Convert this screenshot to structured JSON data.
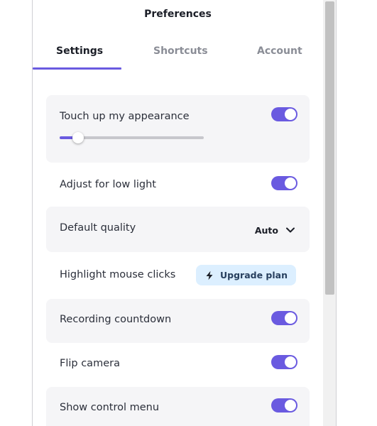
{
  "window": {
    "title": "Preferences"
  },
  "tabs": [
    {
      "label": "Settings",
      "active": true
    },
    {
      "label": "Shortcuts",
      "active": false
    },
    {
      "label": "Account",
      "active": false
    }
  ],
  "settings": {
    "touch_up": {
      "label": "Touch up my appearance",
      "enabled": true,
      "level": 0.13
    },
    "low_light": {
      "label": "Adjust for low light",
      "enabled": true
    },
    "quality": {
      "label": "Default quality",
      "value": "Auto"
    },
    "mouse_clicks": {
      "label": "Highlight mouse clicks",
      "button_label": "Upgrade plan"
    },
    "countdown": {
      "label": "Recording countdown",
      "enabled": true
    },
    "flip_camera": {
      "label": "Flip camera",
      "enabled": true
    },
    "control_menu": {
      "label": "Show control menu",
      "enabled": true
    }
  },
  "colors": {
    "accent": "#6a5ae0",
    "row_shade": "#f5f5f7",
    "upgrade_bg": "#dcefff"
  },
  "icons": {
    "quality_dropdown": "chevron-down-icon",
    "upgrade": "lightning-icon"
  }
}
